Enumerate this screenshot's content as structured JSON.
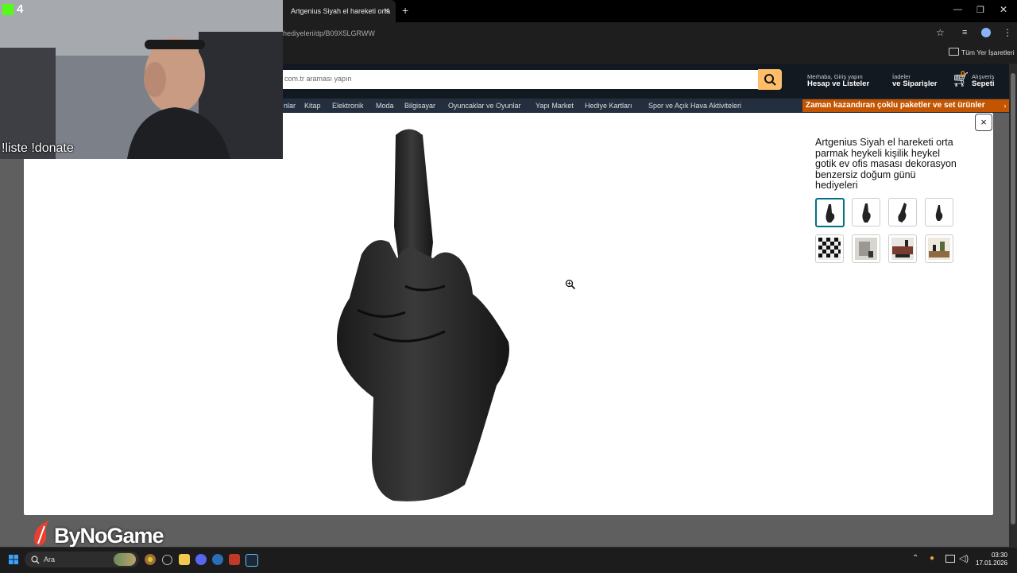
{
  "browser": {
    "tab_title": "Artgenius Siyah el hareketi orta",
    "url": "hediyeleri/dp/B09X5LGRWW",
    "bookmarks_label": "Tüm Yer İşaretleri",
    "new_tab_label": "+",
    "close_tab_label": "×"
  },
  "amazon": {
    "search_placeholder": "com.tr araması yapın",
    "account_small": "Merhaba, Giriş yapın",
    "account_big": "Hesap ve Listeler",
    "orders_small": "İadeler",
    "orders_big": "ve Siparişler",
    "cart_count": "0",
    "cart_small": "Alışveriş",
    "cart_big": "Sepeti",
    "nav_items": [
      "nlar",
      "Kitap",
      "Elektronik",
      "Moda",
      "Bilgisayar",
      "Oyuncaklar ve Oyunlar",
      "Yapı Market",
      "Hediye Kartları",
      "Spor ve Açık Hava Aktiviteleri"
    ],
    "promo": "Zaman kazandıran çoklu paketler ve set ürünler"
  },
  "modal": {
    "close_label": "×",
    "product_title": "Artgenius Siyah el hareketi orta parmak heykeli kişilik heykel gotik ev ofis masası dekorasyon benzersiz doğum günü hediyeleri",
    "thumbnail_count": 8,
    "selected_thumbnail": 1
  },
  "overlay": {
    "viewer_count": "4",
    "chat_commands": "!liste !donate",
    "logo_text": "ByNoGame"
  },
  "taskbar": {
    "search_label": "Ara",
    "time": "03:30",
    "date": "17.01.2026"
  },
  "colors": {
    "amazon_dark": "#131921",
    "amazon_nav": "#232f3e",
    "search_button": "#febd69",
    "promo": "#c45500",
    "selected_thumb": "#007185",
    "kick_green": "#53fc18"
  }
}
